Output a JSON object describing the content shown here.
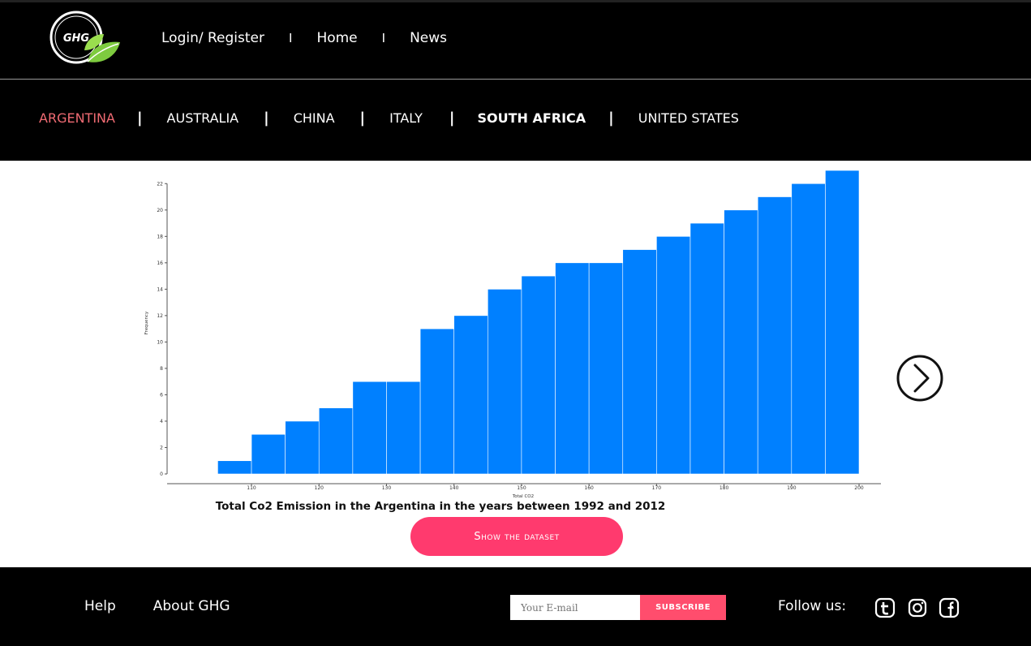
{
  "header": {
    "logo_text": "GHG",
    "nav": [
      "Login/ Register",
      "Home",
      "News"
    ],
    "nav_separator": "I"
  },
  "countries": {
    "items": [
      "ARGENTINA",
      "AUSTRALIA",
      "CHINA",
      "ITALY",
      "SOUTH AFRICA",
      "UNITED STATES"
    ],
    "active": "ARGENTINA",
    "separator": "|",
    "active_color": "#f06b73"
  },
  "chart_data": {
    "type": "bar",
    "xlabel": "Total CO2",
    "ylabel": "Frequency",
    "bar_color": "#0080ff",
    "bins_start": [
      105,
      110,
      115,
      120,
      125,
      130,
      135,
      140,
      145,
      150,
      155,
      160,
      165,
      170,
      175,
      180,
      185,
      190,
      195
    ],
    "bin_width": 5,
    "values": [
      1,
      3,
      4,
      5,
      7,
      7,
      11,
      12,
      14,
      15,
      16,
      16,
      17,
      18,
      19,
      20,
      21,
      22,
      23
    ],
    "xticks": [
      110,
      120,
      130,
      140,
      150,
      160,
      170,
      180,
      190,
      200
    ],
    "yticks": [
      0,
      2,
      4,
      6,
      8,
      10,
      12,
      14,
      16,
      18,
      20,
      22
    ],
    "xlim": [
      97.5,
      203
    ],
    "ylim": [
      0,
      23
    ]
  },
  "chart_caption": "Total Co2 Emission in the Argentina in the years between 1992 and 2012",
  "dataset_button": "Show the dataset",
  "footer": {
    "links": [
      "Help",
      "About GHG"
    ],
    "email_placeholder": "Your E-mail",
    "subscribe_label": "SUBSCRIBE",
    "follow_label": "Follow us:",
    "social_icons": [
      "tumblr-icon",
      "instagram-icon",
      "facebook-icon"
    ]
  }
}
